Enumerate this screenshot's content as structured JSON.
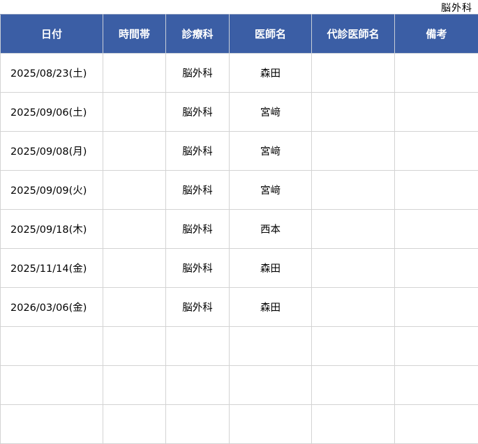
{
  "header_label": "脳外科",
  "columns": [
    "日付",
    "時間帯",
    "診療科",
    "医師名",
    "代診医師名",
    "備考"
  ],
  "rows": [
    {
      "date": "2025/08/23(土)",
      "time": "",
      "dept": "脳外科",
      "doctor": "森田",
      "substitute": "",
      "note": ""
    },
    {
      "date": "2025/09/06(土)",
      "time": "",
      "dept": "脳外科",
      "doctor": "宮﨑",
      "substitute": "",
      "note": ""
    },
    {
      "date": "2025/09/08(月)",
      "time": "",
      "dept": "脳外科",
      "doctor": "宮﨑",
      "substitute": "",
      "note": ""
    },
    {
      "date": "2025/09/09(火)",
      "time": "",
      "dept": "脳外科",
      "doctor": "宮﨑",
      "substitute": "",
      "note": ""
    },
    {
      "date": "2025/09/18(木)",
      "time": "",
      "dept": "脳外科",
      "doctor": "西本",
      "substitute": "",
      "note": ""
    },
    {
      "date": "2025/11/14(金)",
      "time": "",
      "dept": "脳外科",
      "doctor": "森田",
      "substitute": "",
      "note": ""
    },
    {
      "date": "2026/03/06(金)",
      "time": "",
      "dept": "脳外科",
      "doctor": "森田",
      "substitute": "",
      "note": ""
    },
    {
      "date": "",
      "time": "",
      "dept": "",
      "doctor": "",
      "substitute": "",
      "note": ""
    },
    {
      "date": "",
      "time": "",
      "dept": "",
      "doctor": "",
      "substitute": "",
      "note": ""
    },
    {
      "date": "",
      "time": "",
      "dept": "",
      "doctor": "",
      "substitute": "",
      "note": ""
    }
  ],
  "colors": {
    "header_bg": "#3b5ea5",
    "header_text": "#ffffff",
    "grid": "#d3d3d3"
  }
}
